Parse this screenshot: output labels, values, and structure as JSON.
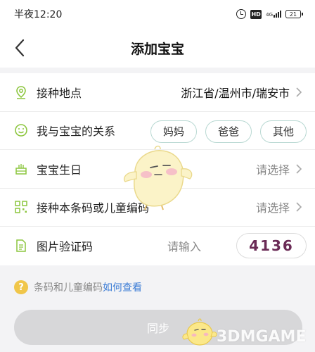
{
  "statusbar": {
    "time": "半夜12:20",
    "signal_label": "4G",
    "battery": "21"
  },
  "navbar": {
    "title": "添加宝宝"
  },
  "form": {
    "location": {
      "label": "接种地点",
      "value": "浙江省/温州市/瑞安市"
    },
    "relation": {
      "label": "我与宝宝的关系",
      "options": [
        "妈妈",
        "爸爸",
        "其他"
      ]
    },
    "birthday": {
      "label": "宝宝生日",
      "placeholder": "请选择"
    },
    "barcode": {
      "label": "接种本条码或儿童编码",
      "placeholder": "请选择"
    },
    "captcha": {
      "label": "图片验证码",
      "placeholder": "请输入",
      "code": "4136"
    }
  },
  "tip": {
    "icon": "?",
    "text": "条码和儿童编码",
    "link": "如何查看"
  },
  "submit": {
    "label": "同步"
  },
  "watermark": {
    "text": "3DMGAME"
  },
  "colors": {
    "icon_green": "#8cc63e",
    "link_blue": "#3a7bd5",
    "pill_border": "#b8d8d2",
    "captcha_text": "#6a2a55"
  }
}
